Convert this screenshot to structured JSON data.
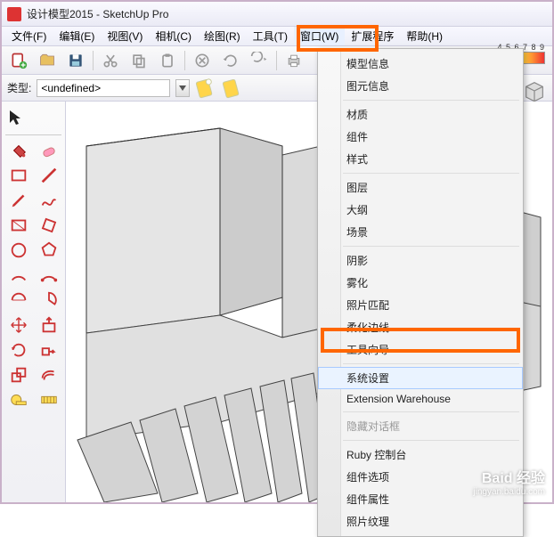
{
  "title": "设计模型2015 - SketchUp Pro",
  "menubar": [
    "文件(F)",
    "编辑(E)",
    "视图(V)",
    "相机(C)",
    "绘图(R)",
    "工具(T)",
    "窗口(W)",
    "扩展程序",
    "帮助(H)"
  ],
  "menubar_visible": [
    "文件(F)",
    "编辑(E)",
    "视图(V)",
    "相机(C)",
    "绘图(R)",
    "工具(T)",
    "窗口(W)",
    "扩展程序",
    "帮助(H)"
  ],
  "menubar_ext_partial": "扩展程序",
  "toolbar2": {
    "type_label": "类型:",
    "type_value": "<undefined>"
  },
  "legend_nums": "4 5 6 7 8 9",
  "dropdown": {
    "groups": [
      [
        "模型信息",
        "图元信息"
      ],
      [
        "材质",
        "组件",
        "样式"
      ],
      [
        "图层",
        "大纲",
        "场景"
      ],
      [
        "阴影",
        "雾化",
        "照片匹配",
        "柔化边线",
        "工具向导"
      ],
      [
        "系统设置",
        "Extension Warehouse"
      ],
      [
        "隐藏对话框"
      ],
      [
        "Ruby 控制台",
        "组件选项",
        "组件属性",
        "照片纹理"
      ]
    ],
    "selected": "系统设置",
    "disabled": [
      "隐藏对话框"
    ]
  },
  "watermark": {
    "big": "Baid 经验",
    "small": "jingyan.baidu.com"
  }
}
